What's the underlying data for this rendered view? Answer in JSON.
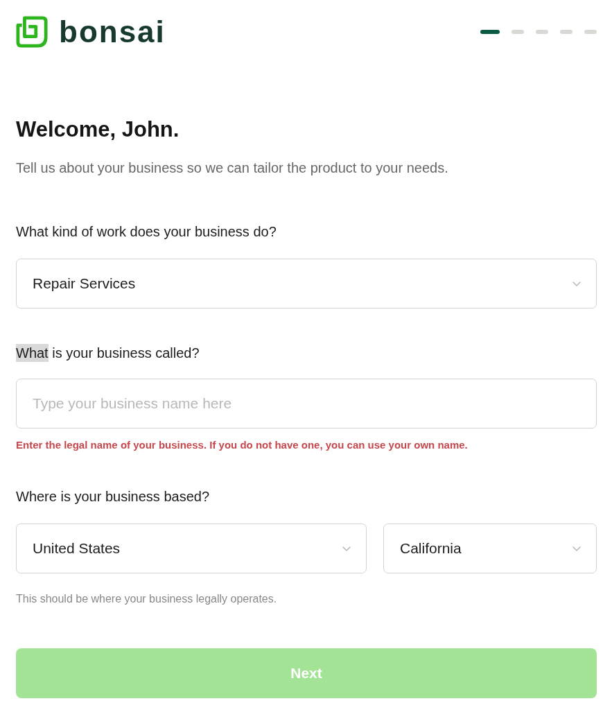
{
  "logo": {
    "text": "bonsai"
  },
  "progress_steps": [
    {
      "selected": true
    },
    {
      "selected": false
    },
    {
      "selected": false
    },
    {
      "selected": false
    },
    {
      "selected": false
    }
  ],
  "heading": "Welcome, John.",
  "subtitle": "Tell us about your business so we can tailor the product to your needs.",
  "questions": [
    {
      "kind": "select",
      "label_parts": [
        {
          "text": "What kind of work does your business do?",
          "selected": false
        }
      ],
      "selects": [
        {
          "value": "Repair Services"
        }
      ]
    },
    {
      "kind": "text",
      "label_parts": [
        {
          "text": "What",
          "selected": true
        },
        {
          "text": " is your business called?",
          "selected": false
        }
      ],
      "placeholder": "Type your business name here",
      "error": "Enter the legal name of your business. If you do not have one, you can use your own name."
    },
    {
      "kind": "select",
      "label_parts": [
        {
          "text": "Where is your business based?",
          "selected": false
        }
      ],
      "selects": [
        {
          "value": "United States"
        },
        {
          "value": "California"
        }
      ],
      "hint": "This should be where your business legally operates."
    }
  ],
  "next_button": {
    "label": "Next",
    "disabled": true
  }
}
